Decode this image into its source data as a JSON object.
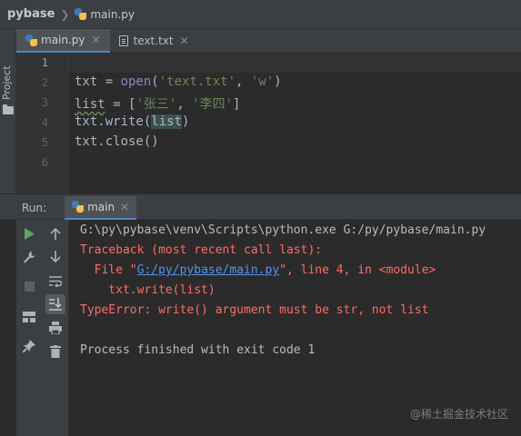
{
  "breadcrumb": {
    "project": "pybase",
    "file": "main.py"
  },
  "project_strip": {
    "label": "Project"
  },
  "tabs": [
    {
      "label": "main.py",
      "active": true
    },
    {
      "label": "text.txt",
      "active": false
    }
  ],
  "editor": {
    "line_numbers": [
      "1",
      "2",
      "3",
      "4",
      "5",
      "6"
    ],
    "lines": {
      "l2": {
        "a": "txt = ",
        "b": "open",
        "c": "(",
        "d": "'text.txt'",
        "e": ", ",
        "f": "'w'",
        "g": ")"
      },
      "l3": {
        "a": "list",
        "b": " = [",
        "c": "'张三'",
        "d": ", ",
        "e": "'李四'",
        "f": "]"
      },
      "l4": {
        "a": "txt.write(",
        "b": "list",
        "c": ")"
      },
      "l5": {
        "a": "txt.close()"
      }
    }
  },
  "run_panel": {
    "label": "Run:",
    "tab": "main",
    "console": {
      "command": "G:\\py\\pybase\\venv\\Scripts\\python.exe G:/py/pybase/main.py",
      "traceback": "Traceback (most recent call last):",
      "file_prefix": "  File \"",
      "file_link": "G:/py/pybase/main.py",
      "file_suffix": "\", line 4, in <module>",
      "code_line": "    txt.write(list)",
      "error": "TypeError: write() argument must be str, not list",
      "finished": "Process finished with exit code 1"
    }
  },
  "watermark": "@稀土掘金技术社区",
  "colors": {
    "accent": "#4a88c7",
    "error": "#ff6b68",
    "link": "#5394ec",
    "string": "#6a8759",
    "builtin": "#8888c6",
    "run_green": "#59a869"
  }
}
